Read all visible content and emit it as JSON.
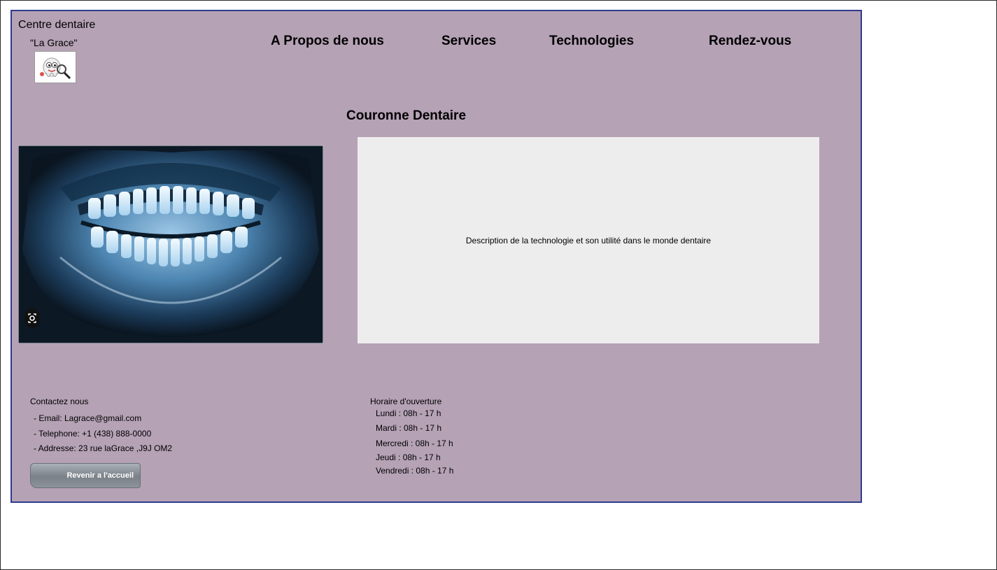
{
  "brand": {
    "name": "Centre dentaire",
    "subtitle": "\"La Grace\"",
    "logo_icon": "tooth-magnifier-icon"
  },
  "nav": {
    "items": [
      {
        "label": "A Propos de nous"
      },
      {
        "label": "Services"
      },
      {
        "label": "Technologies"
      },
      {
        "label": "Rendez-vous"
      }
    ]
  },
  "main": {
    "title": "Couronne Dentaire",
    "image_icon": "panoramic-dental-xray-image",
    "lens_icon": "image-search-icon",
    "description": "Description de la technologie et son utilité dans le monde dentaire"
  },
  "contact": {
    "heading": "Contactez nous",
    "email": "- Email: Lagrace@gmail.com",
    "phone": "- Telephone: +1 (438) 888-0000",
    "address": "- Addresse: 23 rue laGrace ,J9J OM2"
  },
  "hours": {
    "heading": "Horaire d'ouverture",
    "days": [
      "Lundi : 08h - 17 h",
      "Mardi : 08h - 17 h",
      "Mercredi : 08h - 17 h",
      "Jeudi : 08h - 17 h",
      "Vendredi : 08h - 17 h"
    ]
  },
  "home_button": {
    "label": "Revenir a l'accueil"
  },
  "colors": {
    "page_background": "#b5a2b5",
    "page_border": "#2e3a8c",
    "description_box": "#ededed",
    "button_gradient": "#7a8189"
  }
}
